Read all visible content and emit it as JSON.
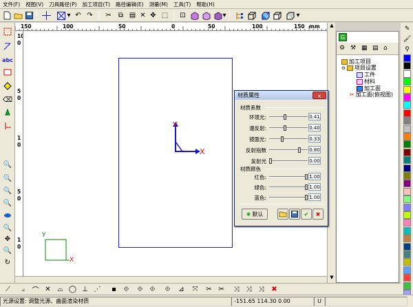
{
  "menu": [
    "文件(F)",
    "视图(V)",
    "刀具路径(P)",
    "加工项目(T)",
    "路径编辑(E)",
    "测量(M)",
    "工具(T)",
    "帮助(H)"
  ],
  "ruler": {
    "h_labels": [
      "150",
      "100",
      "50",
      "0",
      "50",
      "100",
      "150",
      "mm"
    ],
    "v_labels": [
      "10",
      "0",
      "5",
      "0",
      "1",
      "0",
      "5",
      "0",
      "1",
      "0"
    ],
    "unit": "mm"
  },
  "canvas": {
    "axis_y": "Y",
    "axis_x": "X",
    "axis_color": "#1515d8",
    "label_color": "#e01010",
    "corner_axis_color": "#008800"
  },
  "tree": {
    "items": [
      "加工项目",
      "项目设置",
      "工件",
      "材料",
      "加工面",
      "加工面(俯视图)"
    ]
  },
  "dialog": {
    "title": "材质属性",
    "close_label": "x",
    "group1": "材质系数",
    "props": [
      {
        "label": "环境光:",
        "value": "0.41",
        "level": 0.41
      },
      {
        "label": "漫反射:",
        "value": "0.40",
        "level": 0.4
      },
      {
        "label": "镜面光:",
        "value": "0.33",
        "level": 0.33
      },
      {
        "label": "反射指数",
        "value": "0.80",
        "level": 0.8
      },
      {
        "label": "发射光",
        "value": "0.00",
        "level": 0.0
      }
    ],
    "group2": "材质颜色",
    "colors": [
      {
        "label": "红色:",
        "value": "1.00",
        "level": 1.0
      },
      {
        "label": "绿色:",
        "value": "1.00",
        "level": 1.0
      },
      {
        "label": "蓝色:",
        "value": "1.00",
        "level": 1.0
      }
    ],
    "default_label": "默认"
  },
  "palette": [
    "#0000ff",
    "#000000",
    "#ffffff",
    "#00ff00",
    "#ffff00",
    "#ff00ff",
    "#00ffff",
    "#ff0000",
    "#808080",
    "#c0c0c0",
    "#ff8000",
    "#008000",
    "#800000",
    "#008080",
    "#000080",
    "#808000",
    "#800080",
    "#ffc0c0",
    "#80ff80",
    "#8080ff",
    "#c0ff00",
    "#ff80c0",
    "#00c0c0",
    "#c08040",
    "#004080",
    "#408080",
    "#c0c000",
    "#60a0ff",
    "#ff4040",
    "#40c040",
    "#a0a0ff",
    "#ffe080"
  ],
  "status": {
    "message": "光源设置: 调整光源、曲面渲染材质",
    "coords": "-151.65  114.30  0.00",
    "mode": "U"
  }
}
